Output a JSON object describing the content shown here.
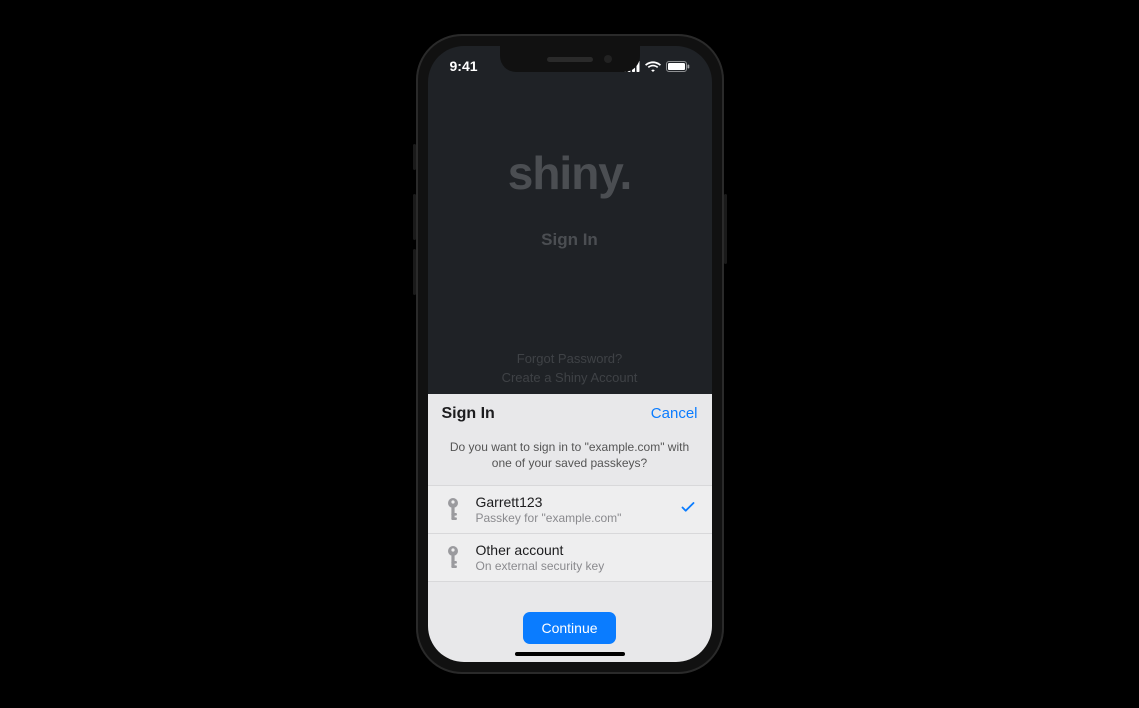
{
  "status": {
    "time": "9:41"
  },
  "background_app": {
    "logo": "shiny.",
    "signin_label": "Sign In",
    "forgot_label": "Forgot Password?",
    "create_label": "Create a Shiny Account"
  },
  "sheet": {
    "title": "Sign In",
    "cancel_label": "Cancel",
    "prompt": "Do you want to sign in to \"example.com\" with one of your saved passkeys?",
    "options": [
      {
        "primary": "Garrett123",
        "secondary": "Passkey for \"example.com\"",
        "selected": true
      },
      {
        "primary": "Other account",
        "secondary": "On external security key",
        "selected": false
      }
    ],
    "continue_label": "Continue"
  }
}
